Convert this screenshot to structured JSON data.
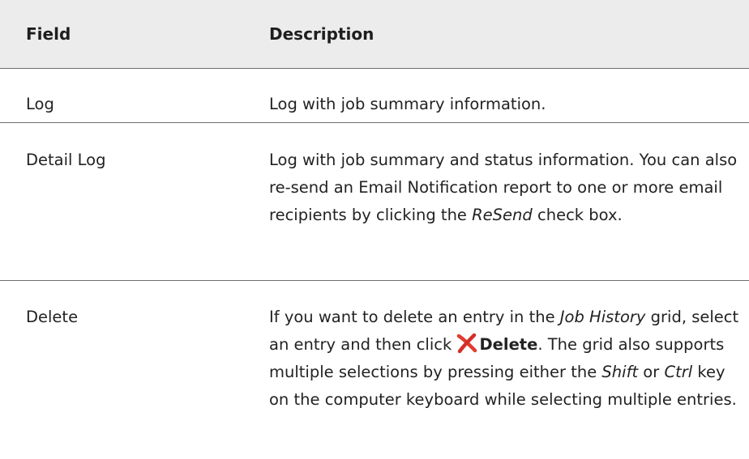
{
  "table": {
    "headers": {
      "field": "Field",
      "description": "Description"
    },
    "rows": [
      {
        "field": "Log",
        "description": "Log with job summary information."
      },
      {
        "field": "Detail Log",
        "description_parts": [
          "Log with job summary and status information. You can also re-send an Email Notification report to one or more email recipients by clicking the ",
          "ReSend",
          " check box."
        ]
      },
      {
        "field": "Delete",
        "description_parts": [
          "If you want to delete an entry in the ",
          "Job History",
          " grid, select an entry and then click ",
          "Delete",
          ". The grid also supports multiple selections by pressing either the ",
          "Shift",
          " or ",
          "Ctrl",
          " key on the computer keyboard while selecting multiple entries."
        ],
        "icon": "delete-x-icon",
        "icon_color": "#e23b2e"
      }
    ]
  }
}
